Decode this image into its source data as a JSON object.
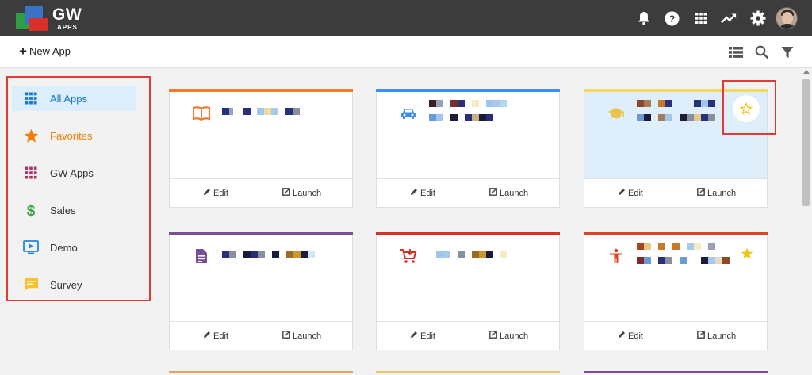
{
  "header": {
    "logo_text": "GW",
    "logo_sub": "APPS",
    "icons": [
      "bell-icon",
      "help-icon",
      "apps-grid-icon",
      "trending-icon",
      "gear-icon",
      "avatar"
    ]
  },
  "toolbar": {
    "new_app_label": "New App",
    "icons": [
      "list-view-icon",
      "search-icon",
      "filter-icon"
    ]
  },
  "sidebar": {
    "items": [
      {
        "label": "All Apps",
        "icon": "grid-icon",
        "color": "#1976d2",
        "active": true
      },
      {
        "label": "Favorites",
        "icon": "star-icon",
        "color": "#f57c00"
      },
      {
        "label": "GW Apps",
        "icon": "dots-grid-icon",
        "color": "#b0306a"
      },
      {
        "label": "Sales",
        "icon": "dollar-icon",
        "color": "#43a047"
      },
      {
        "label": "Demo",
        "icon": "monitor-play-icon",
        "color": "#1e88e5"
      },
      {
        "label": "Survey",
        "icon": "chat-icon",
        "color": "#fbc02d"
      }
    ]
  },
  "cards": [
    {
      "accent": "#f07a30",
      "icon": "book-icon",
      "icon_color": "#f07a30",
      "edit": "Edit",
      "launch": "Launch"
    },
    {
      "accent": "#3d8ef0",
      "icon": "car-icon",
      "icon_color": "#3d8ef0",
      "edit": "Edit",
      "launch": "Launch"
    },
    {
      "accent": "#f3d966",
      "icon": "graduation-cap-icon",
      "icon_color": "#e8c547",
      "edit": "Edit",
      "launch": "Launch",
      "highlighted": true
    },
    {
      "accent": "#7a4f9a",
      "icon": "document-icon",
      "icon_color": "#7a4f9a",
      "edit": "Edit",
      "launch": "Launch"
    },
    {
      "accent": "#d93025",
      "icon": "cart-icon",
      "icon_color": "#d93025",
      "edit": "Edit",
      "launch": "Launch"
    },
    {
      "accent": "#e0421e",
      "icon": "accessibility-icon",
      "icon_color": "#e0421e",
      "edit": "Edit",
      "launch": "Launch",
      "favorite": true
    }
  ],
  "colors": {
    "topbar": "#3c3c3c",
    "highlight_box": "#e53935",
    "active_blue": "#1976d2",
    "star_yellow": "#f1c40f"
  }
}
